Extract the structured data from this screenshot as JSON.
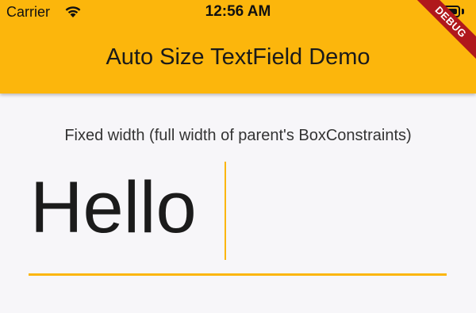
{
  "status_bar": {
    "carrier": "Carrier",
    "time": "12:56 AM",
    "wifi_icon": "wifi-icon",
    "battery_icon": "battery-icon"
  },
  "app_bar": {
    "title": "Auto Size TextField Demo",
    "background_color": "#fcb60c"
  },
  "debug_banner": {
    "label": "DEBUG",
    "color": "#b0181c"
  },
  "main": {
    "field_label": "Fixed width (full width of parent's BoxConstraints)",
    "text_field_value": "Hello",
    "accent_color": "#fcb60c"
  }
}
